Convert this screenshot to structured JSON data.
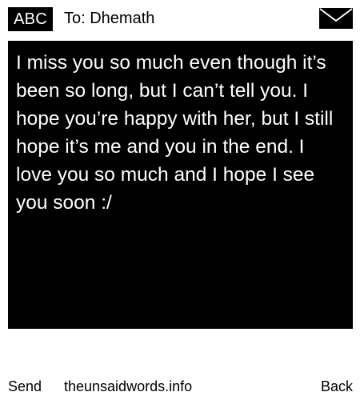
{
  "header": {
    "input_mode_label": "ABC",
    "recipient_line": "To: Dhemath",
    "envelope_icon": "envelope-icon"
  },
  "message": {
    "body": "I miss you so much even though it’s been so long, but I can’t tell you. I hope you’re happy with her, but I still hope it’s me and you in the end. I love you so much and I hope I see you soon :/"
  },
  "footer": {
    "send_label": "Send",
    "site_label": "theunsaidwords.info",
    "back_label": "Back"
  },
  "colors": {
    "background": "#ffffff",
    "message_background": "#000000",
    "message_text": "#ffffff",
    "text": "#000000"
  }
}
